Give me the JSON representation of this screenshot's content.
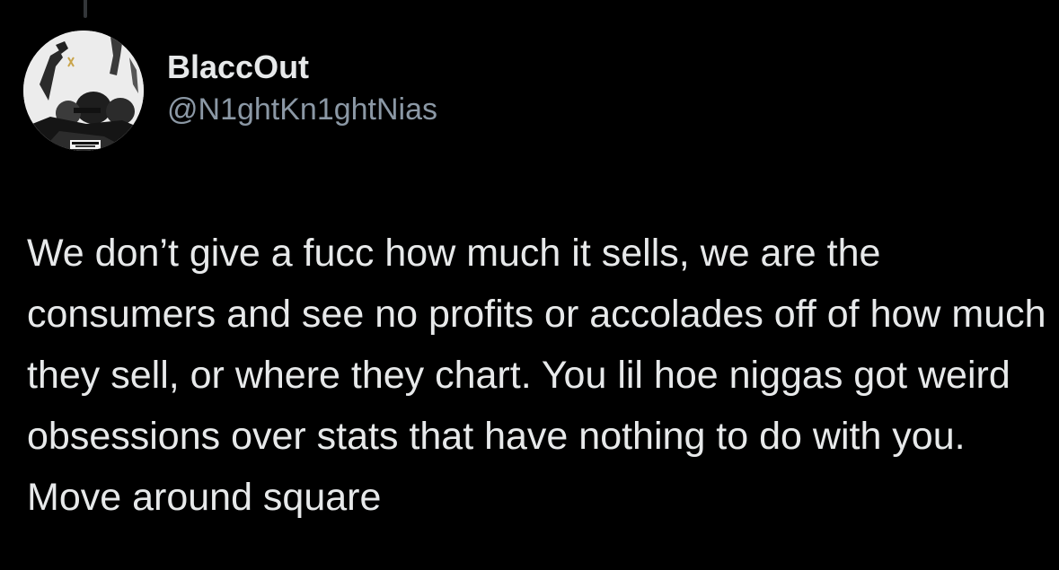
{
  "author": {
    "display_name": "BlaccOut",
    "handle": "@N1ghtKn1ghtNias",
    "avatar_icon": "profile-photo"
  },
  "tweet": {
    "text": "We don’t give a fucc how much it sells, we are the consumers and see no profits or accolades off of how much they sell, or where they chart. You lil hoe niggas got weird obsessions over stats that have nothing to do with you. Move around square"
  },
  "colors": {
    "background": "#000000",
    "text_primary": "#e7e9ea",
    "text_secondary": "#8b98a5",
    "thread_line": "#333639"
  }
}
